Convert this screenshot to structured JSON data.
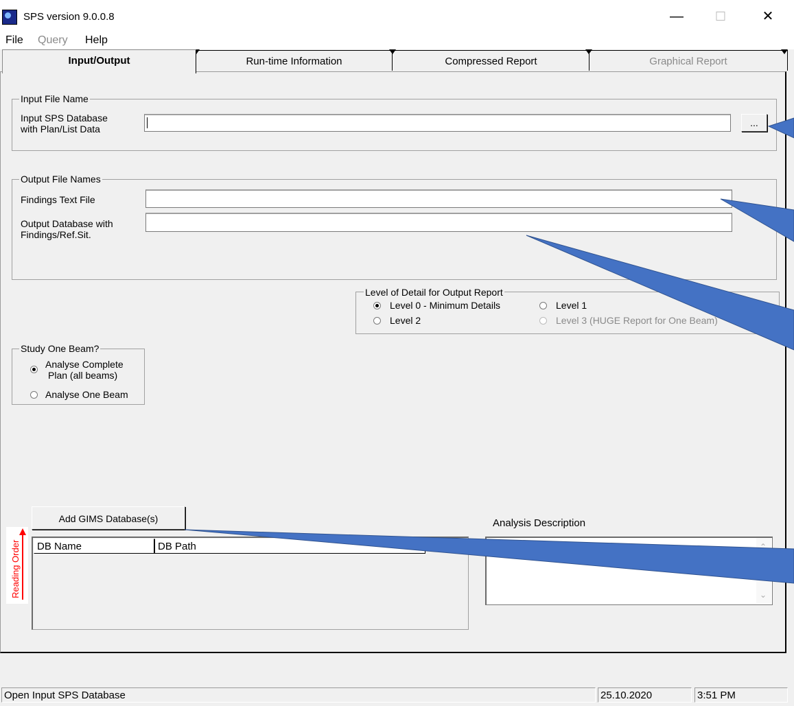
{
  "window": {
    "title": "SPS version 9.0.0.8",
    "minimize": "—",
    "maximize": "☐",
    "close": "✕"
  },
  "menu": {
    "file": "File",
    "query": "Query",
    "help": "Help"
  },
  "tabs": [
    "Input/Output",
    "Run-time Information",
    "Compressed Report",
    "Graphical Report"
  ],
  "input_group": {
    "legend": "Input File Name",
    "label_line1": "Input SPS Database",
    "label_line2": "with Plan/List Data",
    "value": "",
    "browse_label": "..."
  },
  "output_group": {
    "legend": "Output File Names",
    "findings_label": "Findings Text File",
    "findings_value": "",
    "db_label_line1": "Output Database with",
    "db_label_line2": "Findings/Ref.Sit.",
    "db_value": ""
  },
  "detail_group": {
    "legend": "Level of Detail for Output Report",
    "level0": "Level 0 -  Minimum Details",
    "level1": "Level 1",
    "level2": "Level 2",
    "level3": "Level 3 (HUGE Report for One Beam)",
    "selected": "level0"
  },
  "beam_group": {
    "legend": "Study One Beam?",
    "complete_line1": "Analyse Complete",
    "complete_line2": "Plan (all beams)",
    "one_beam": "Analyse One Beam",
    "selected": "complete"
  },
  "gims": {
    "add_button": "Add GIMS Database(s)",
    "columns": [
      "DB Name",
      "DB Path"
    ],
    "rows": []
  },
  "analysis": {
    "label": "Analysis Description",
    "value": ""
  },
  "reading_order": "Reading Order",
  "status": {
    "message": "Open Input SPS Database",
    "date": "25.10.2020",
    "time": "3:51 PM"
  },
  "colors": {
    "arrow": "#4472c4",
    "reading_order": "#ff0000"
  }
}
